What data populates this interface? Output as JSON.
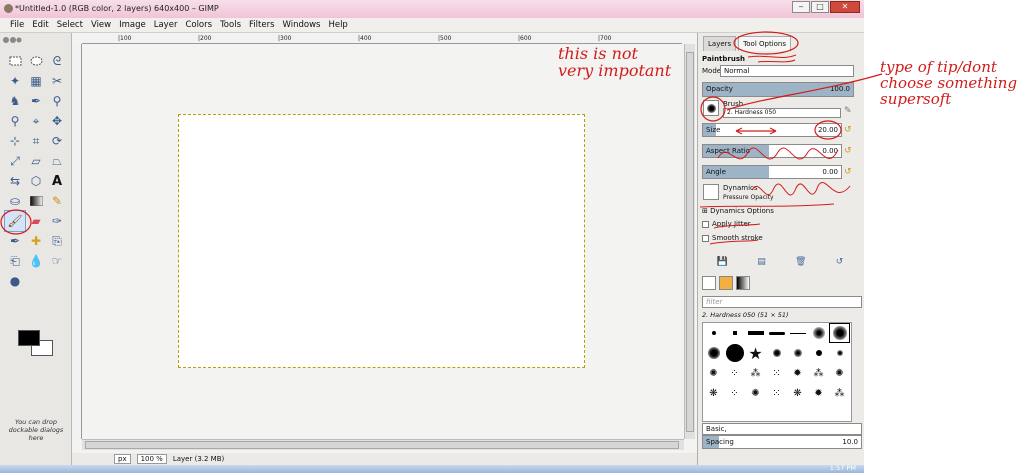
{
  "window": {
    "title": "*Untitled-1.0 (RGB color, 2 layers) 640x400 – GIMP"
  },
  "menu": [
    "File",
    "Edit",
    "Select",
    "View",
    "Image",
    "Layer",
    "Colors",
    "Tools",
    "Filters",
    "Windows",
    "Help"
  ],
  "toolbox": {
    "drop_hint": "You can drop dockable dialogs here"
  },
  "ruler": {
    "ticks": [
      "|100",
      "|200",
      "|300",
      "|400",
      "|500",
      "|600",
      "|700"
    ]
  },
  "status": {
    "unit": "px",
    "zoom": "100 %",
    "message": "Layer (3.2 MB)"
  },
  "dock": {
    "tabs": [
      "Layers",
      "Tool Options"
    ],
    "tool_name": "Paintbrush",
    "mode_label": "Mode:",
    "mode_value": "Normal",
    "opacity": {
      "label": "Opacity",
      "value": "100.0"
    },
    "brush": {
      "label": "Brush",
      "name": "2. Hardness 050"
    },
    "size": {
      "label": "Size",
      "value": "20.00"
    },
    "aspect": {
      "label": "Aspect Ratio",
      "value": "0.00"
    },
    "angle": {
      "label": "Angle",
      "value": "0.00"
    },
    "dynamics": {
      "label": "Dynamics",
      "name": "Pressure Opacity"
    },
    "dynamics_options": "Dynamics Options",
    "apply_jitter": "Apply Jitter",
    "smooth_stroke": "Smooth stroke",
    "filter_placeholder": "filter",
    "brush_caption": "2. Hardness 050 (51 × 51)",
    "brush_set": "Basic,",
    "spacing": {
      "label": "Spacing",
      "value": "10.0"
    }
  },
  "annotations": {
    "left": "this is not very impotant",
    "right": "type of tip/dont choose something supersoft"
  },
  "taskbar": {
    "clock": "1:57 PM"
  }
}
